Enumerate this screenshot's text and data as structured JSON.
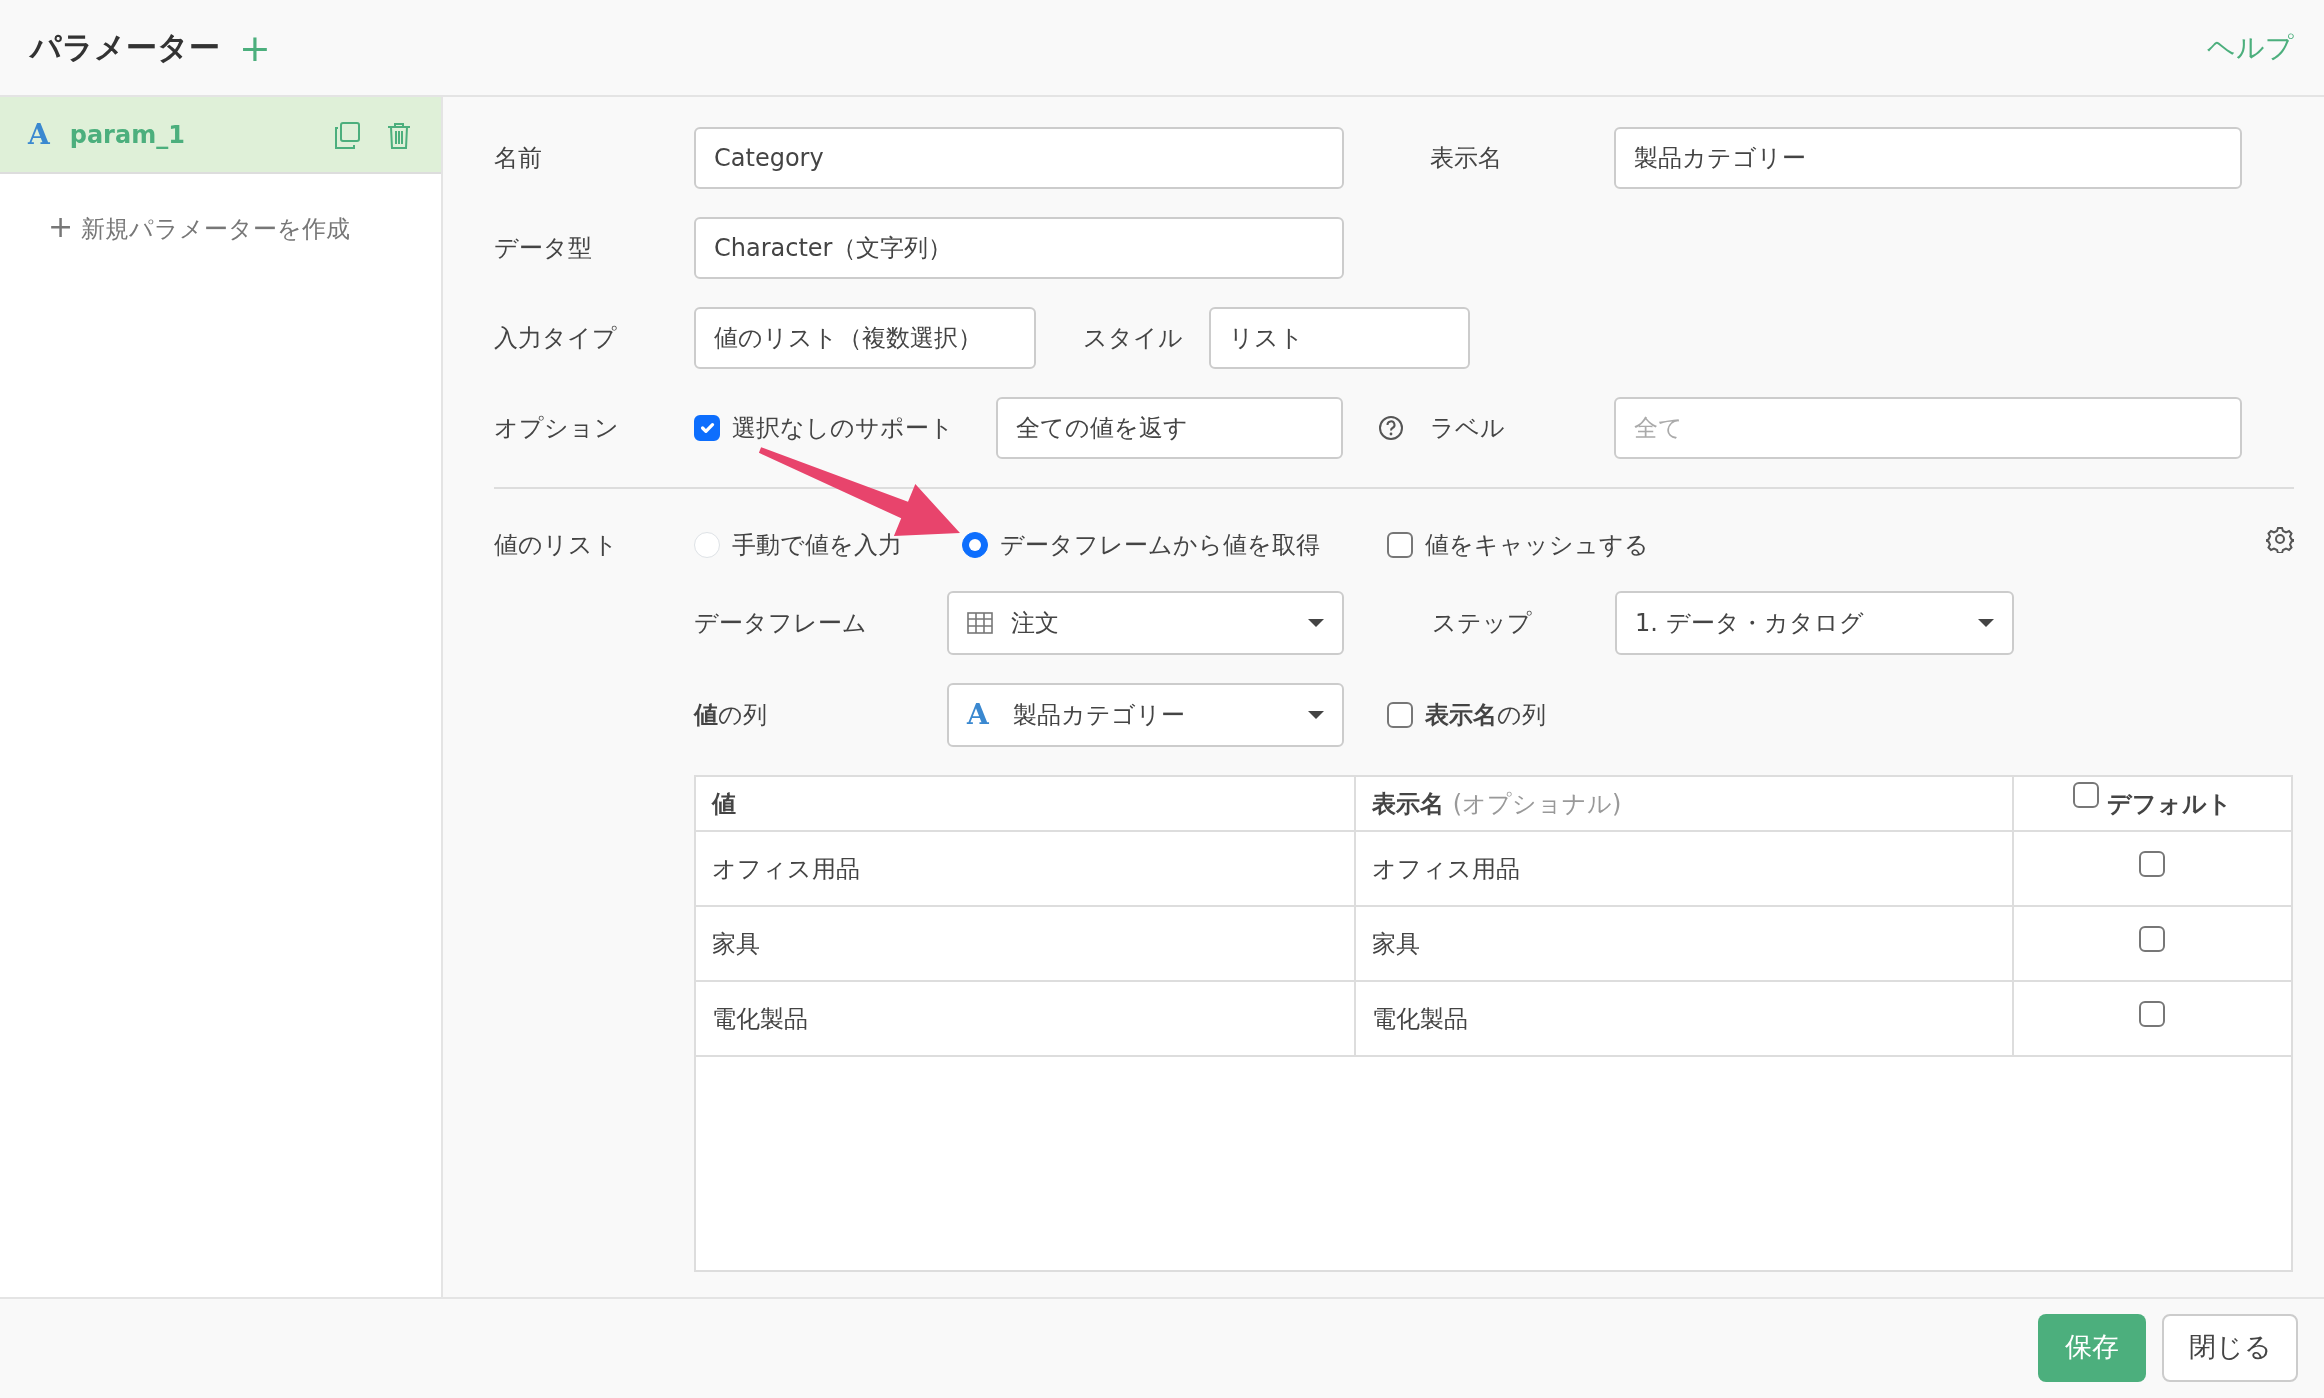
{
  "header": {
    "title": "パラメーター",
    "add": "+",
    "help": "ヘルプ"
  },
  "sidebar": {
    "items": [
      {
        "type_icon": "A",
        "name": "param_1",
        "selected": true
      }
    ],
    "new_param": {
      "icon": "+",
      "label": "新規パラメーターを作成"
    }
  },
  "form": {
    "name": {
      "label": "名前",
      "value": "Category"
    },
    "display_name": {
      "label": "表示名",
      "value": "製品カテゴリー"
    },
    "data_type": {
      "label": "データ型",
      "value": "Character（文字列）"
    },
    "input_type": {
      "label": "入力タイプ",
      "value": "値のリスト（複数選択）"
    },
    "style": {
      "label": "スタイル",
      "value": "リスト"
    },
    "options": {
      "label": "オプション",
      "support_none": {
        "label": "選択なしのサポート",
        "checked": true
      },
      "return_mode": {
        "value": "全ての値を返す"
      }
    },
    "label_field": {
      "label": "ラベル",
      "placeholder": "全て"
    },
    "value_list": {
      "label": "値のリスト",
      "sources": [
        {
          "label": "手動で値を入力",
          "selected": false
        },
        {
          "label": "データフレームから値を取得",
          "selected": true
        }
      ],
      "cache": {
        "label": "値をキャッシュする",
        "checked": false
      },
      "dataframe": {
        "label": "データフレーム",
        "value": "注文"
      },
      "step": {
        "label": "ステップ",
        "value": "1. データ・カタログ"
      },
      "value_column": {
        "label": "**値**の列",
        "type_icon": "A",
        "value": "製品カテゴリー"
      },
      "display_column": {
        "label": "**表示名**の列",
        "checked": false
      }
    }
  },
  "table": {
    "columns": [
      {
        "label": "値"
      },
      {
        "label": "表示名",
        "hint": "(オプショナル)"
      },
      {
        "label": "デフォルト",
        "checked": false
      }
    ],
    "rows": [
      {
        "value": "オフィス用品",
        "display": "オフィス用品",
        "default": false
      },
      {
        "value": "家具",
        "display": "家具",
        "default": false
      },
      {
        "value": "電化製品",
        "display": "電化製品",
        "default": false
      }
    ]
  },
  "footer": {
    "buttons": [
      {
        "label": "保存",
        "kind": "primary"
      },
      {
        "label": "閉じる",
        "kind": "secondary"
      }
    ]
  }
}
